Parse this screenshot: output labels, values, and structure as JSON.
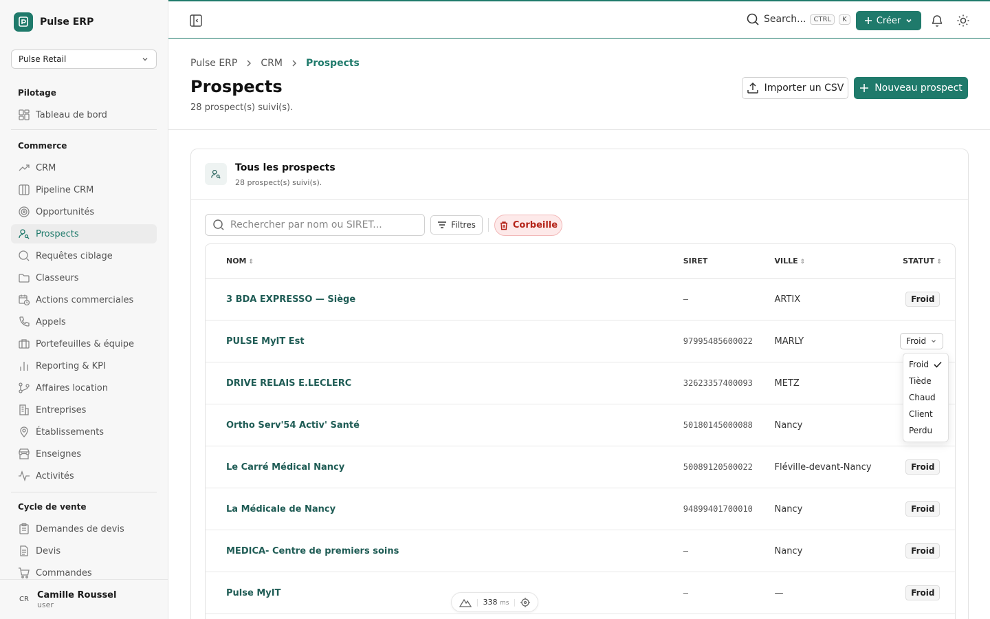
{
  "brand": {
    "name": "Pulse ERP"
  },
  "org_select": {
    "value": "Pulse Retail"
  },
  "sidebar": {
    "pilotage": {
      "title": "Pilotage",
      "items": [
        {
          "label": "Tableau de bord",
          "icon": "dashboard-icon"
        }
      ]
    },
    "commerce": {
      "title": "Commerce",
      "items": [
        {
          "label": "CRM",
          "icon": "trend-icon"
        },
        {
          "label": "Pipeline CRM",
          "icon": "columns-icon"
        },
        {
          "label": "Opportunités",
          "icon": "target-icon"
        },
        {
          "label": "Prospects",
          "icon": "user-search-icon",
          "active": true
        },
        {
          "label": "Requêtes ciblage",
          "icon": "search-icon"
        },
        {
          "label": "Classeurs",
          "icon": "folder-icon"
        },
        {
          "label": "Actions commerciales",
          "icon": "calendar-clock-icon"
        },
        {
          "label": "Appels",
          "icon": "phone-icon"
        },
        {
          "label": "Portefeuilles & équipe",
          "icon": "briefcase-icon"
        },
        {
          "label": "Reporting & KPI",
          "icon": "bar-chart-icon"
        },
        {
          "label": "Affaires location",
          "icon": "git-branch-icon"
        },
        {
          "label": "Entreprises",
          "icon": "building-icon"
        },
        {
          "label": "Établissements",
          "icon": "map-pin-icon"
        },
        {
          "label": "Enseignes",
          "icon": "store-icon"
        },
        {
          "label": "Activités",
          "icon": "activity-icon"
        }
      ]
    },
    "cycle": {
      "title": "Cycle de vente",
      "items": [
        {
          "label": "Demandes de devis",
          "icon": "clipboard-icon"
        },
        {
          "label": "Devis",
          "icon": "file-text-icon"
        },
        {
          "label": "Commandes",
          "icon": "cart-icon"
        }
      ]
    }
  },
  "user": {
    "initials": "CR",
    "name": "Camille Roussel",
    "role": "user"
  },
  "topbar": {
    "search_label": "Search...",
    "kbd_ctrl": "CTRL",
    "kbd_k": "K",
    "create_label": "Créer"
  },
  "breadcrumb": [
    "Pulse ERP",
    "CRM",
    "Prospects"
  ],
  "page": {
    "title": "Prospects",
    "subtitle": "28 prospect(s) suivi(s).",
    "import_label": "Importer un CSV",
    "new_label": "Nouveau prospect"
  },
  "card": {
    "title": "Tous les prospects",
    "subtitle": "28 prospect(s) suivi(s).",
    "search_placeholder": "Rechercher par nom ou SIRET...",
    "filter_label": "Filtres",
    "trash_label": "Corbeille"
  },
  "table": {
    "headers": {
      "nom": "NOM",
      "siret": "SIRET",
      "ville": "VILLE",
      "statut": "STATUT"
    },
    "rows": [
      {
        "nom": "3 BDA EXPRESSO — Siège",
        "siret": "–",
        "ville": "ARTIX",
        "statut": "Froid"
      },
      {
        "nom": "PULSE MyIT Est",
        "siret": "97995485600022",
        "ville": "MARLY",
        "statut": "Froid"
      },
      {
        "nom": "DRIVE RELAIS E.LECLERC",
        "siret": "32623357400093",
        "ville": "METZ",
        "statut": ""
      },
      {
        "nom": "Ortho Serv'54 Activ' Santé",
        "siret": "50180145000088",
        "ville": "Nancy",
        "statut": ""
      },
      {
        "nom": "Le Carré Médical Nancy",
        "siret": "50089120500022",
        "ville": "Fléville-devant-Nancy",
        "statut": "Froid"
      },
      {
        "nom": "La Médicale de Nancy",
        "siret": "94899401700010",
        "ville": "Nancy",
        "statut": "Froid"
      },
      {
        "nom": "MEDICA- Centre de premiers soins",
        "siret": "–",
        "ville": "Nancy",
        "statut": "Froid"
      },
      {
        "nom": "Pulse MyIT",
        "siret": "–",
        "ville": "—",
        "statut": "Froid"
      }
    ]
  },
  "status_dropdown": {
    "options": [
      "Froid",
      "Tiède",
      "Chaud",
      "Client",
      "Perdu"
    ],
    "selected": "Froid"
  },
  "perf": {
    "value": "338",
    "unit": "ms"
  },
  "colors": {
    "accent": "#1f7a6b",
    "danger": "#b42318"
  }
}
